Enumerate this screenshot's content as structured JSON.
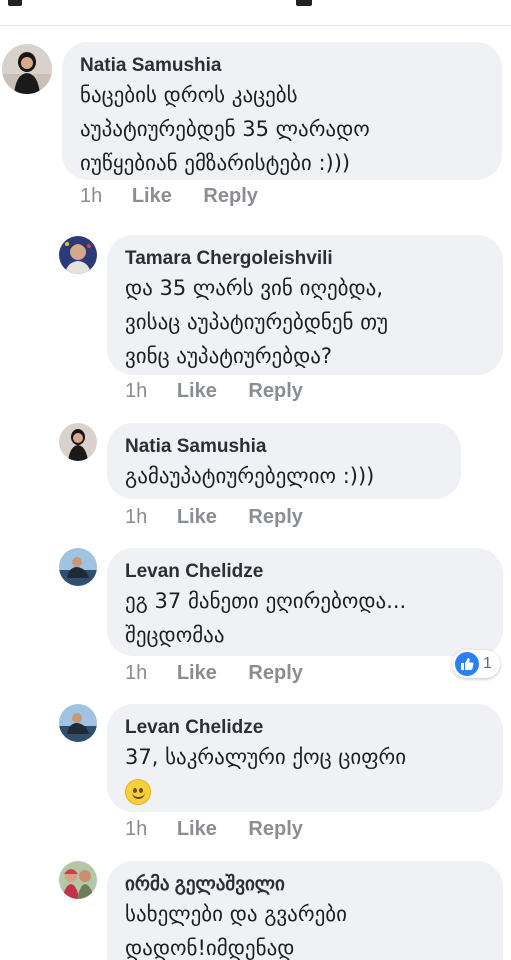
{
  "comments": [
    {
      "author": "Natia Samushia",
      "lines": [
        "ნაცების დროს კაცებს",
        "აუპატიურებდენ 35 ლარადო",
        "იუწყებიან ემზარისტები :)))"
      ],
      "time": "1h",
      "like": "Like",
      "reply": "Reply"
    },
    {
      "author": "Tamara Chergoleishvili",
      "lines": [
        "და 35 ლარს ვინ იღებდა,",
        "ვისაც აუპატიურებდნენ თუ",
        "ვინც აუპატიურებდა?"
      ],
      "time": "1h",
      "like": "Like",
      "reply": "Reply"
    },
    {
      "author": "Natia Samushia",
      "lines": [
        "გამაუპატიურებელიო :)))"
      ],
      "time": "1h",
      "like": "Like",
      "reply": "Reply"
    },
    {
      "author": "Levan Chelidze",
      "lines": [
        "ეგ 37 მანეთი ეღირებოდა...",
        "შეცდომაა"
      ],
      "time": "1h",
      "like": "Like",
      "reply": "Reply",
      "reactions": {
        "icon": "thumbs-up-icon",
        "count": "1"
      }
    },
    {
      "author": "Levan Chelidze",
      "lines": [
        "37, საკრალური ქოც ციფრი"
      ],
      "emoji": "smiley-emoji-icon",
      "time": "1h",
      "like": "Like",
      "reply": "Reply"
    },
    {
      "author": "ირმა გელაშვილი",
      "lines": [
        "სახელები და გვარები",
        "დადონ!იმდენად"
      ]
    }
  ],
  "colors": {
    "bubble": "#eff1f4",
    "meta": "#8a8d91",
    "like_blue": "#2d7ff9"
  }
}
